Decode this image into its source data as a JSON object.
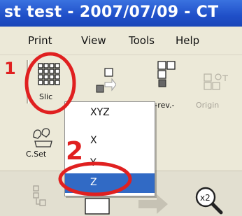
{
  "window": {
    "title": "st  test - 2007/07/09 - CT"
  },
  "menubar": {
    "items": [
      "Print",
      "View",
      "Tools",
      "Help"
    ]
  },
  "toolbar": {
    "slice_label": "Slic",
    "zrev_label": "Z-rev.-",
    "origin_label": "Origin",
    "cset_label": "C.Set"
  },
  "dropdown": {
    "items": [
      "XYZ",
      "X",
      "Y",
      "Z"
    ],
    "selected": "Z"
  },
  "annotations": {
    "step1": "1",
    "step2": "2"
  },
  "colors": {
    "title_bar": "#1f4fc8",
    "selection": "#316ac5",
    "annotation": "#e02020"
  },
  "icons": [
    "slice-grid-icon",
    "z-reverse-icon",
    "origin-icon",
    "pin-icon",
    "cset-icon",
    "magnifier-icon"
  ]
}
